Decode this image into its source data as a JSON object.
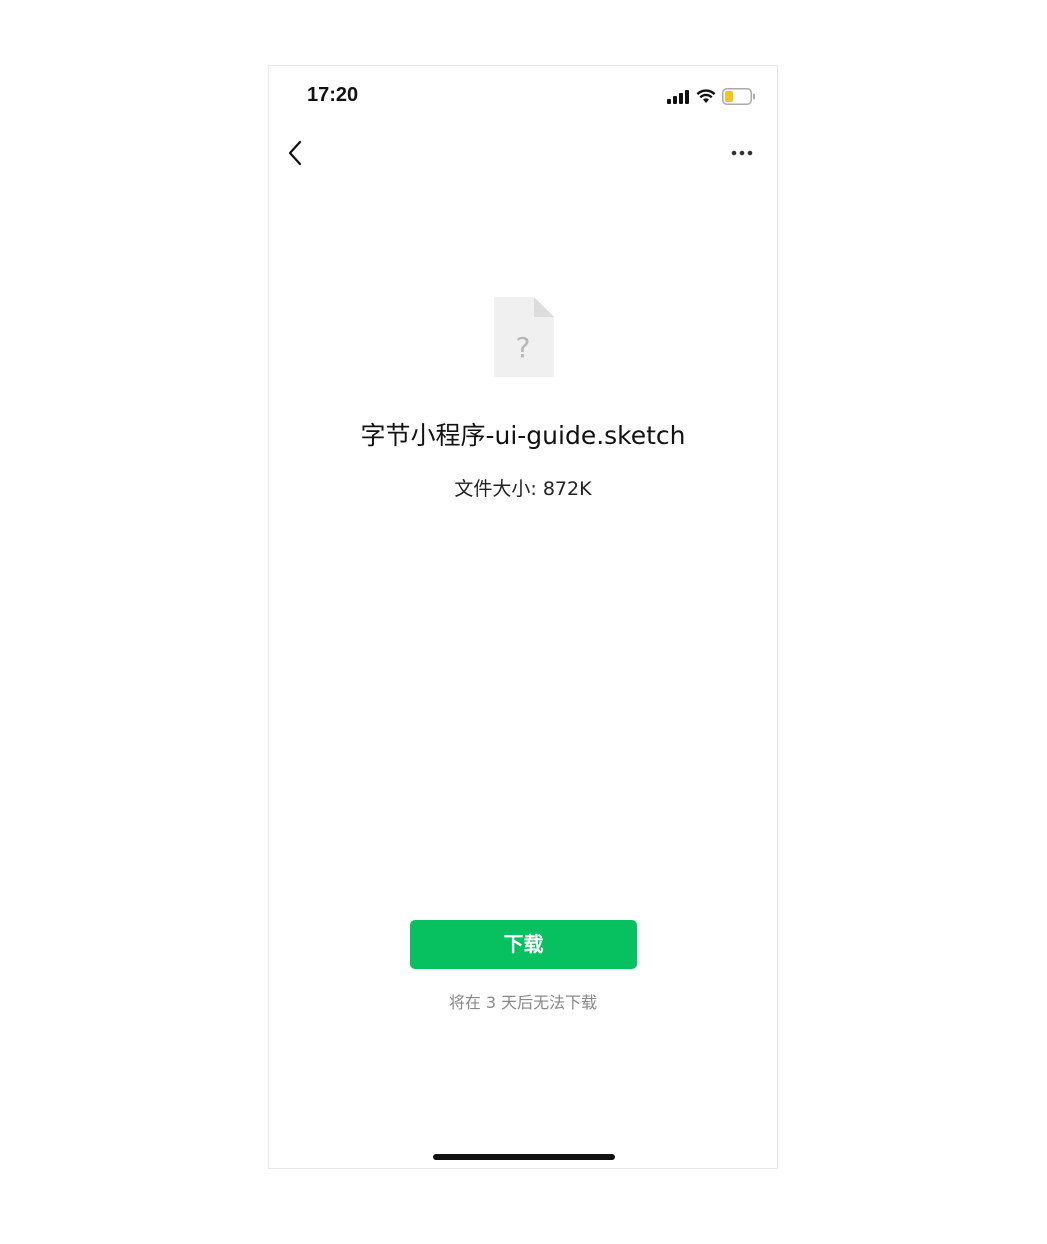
{
  "status_bar": {
    "time": "17:20",
    "signal_icon": "cellular-signal-icon",
    "wifi_icon": "wifi-icon",
    "battery_icon": "battery-low-icon",
    "battery_color": "#f5c518"
  },
  "nav": {
    "back_icon": "chevron-left-icon",
    "more_icon": "more-dots-icon"
  },
  "file": {
    "icon": "unknown-file-icon",
    "icon_glyph": "?",
    "name": "字节小程序-ui-guide.sketch",
    "size_text": "文件大小: 872K"
  },
  "actions": {
    "download_label": "下载",
    "download_color": "#07c160",
    "expire_note": "将在 3 天后无法下载"
  }
}
